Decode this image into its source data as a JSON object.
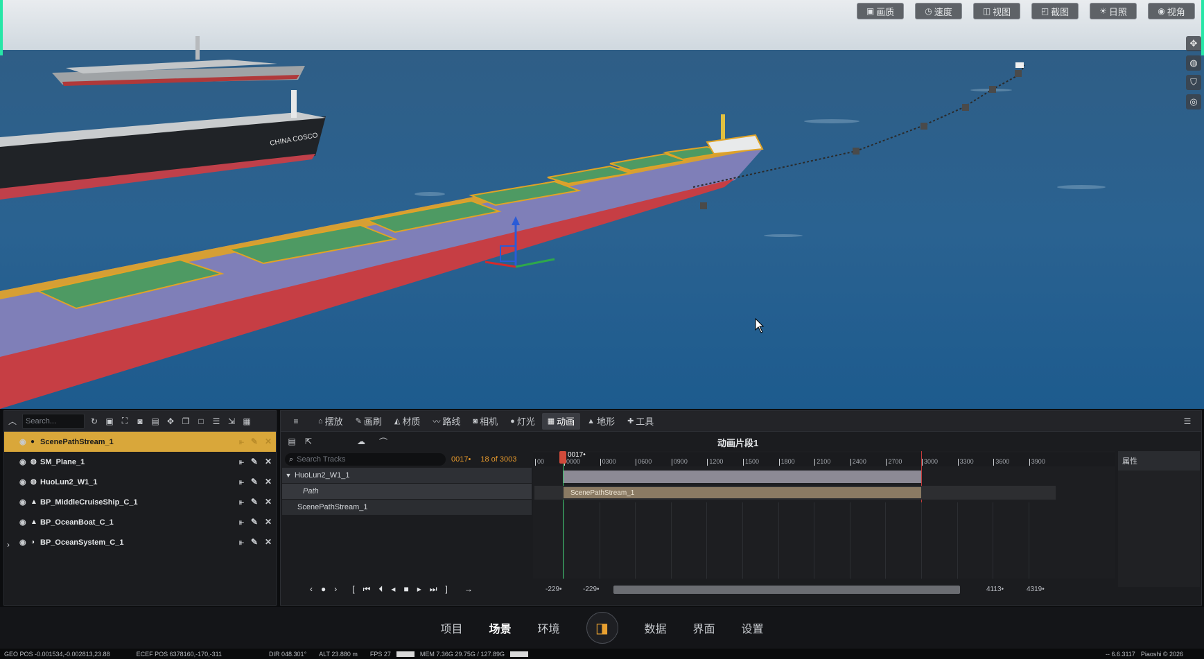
{
  "viewport": {
    "top_buttons": [
      {
        "icon": "image-icon",
        "glyph": "▣",
        "label": "画质"
      },
      {
        "icon": "speed-icon",
        "glyph": "◷",
        "label": "速度"
      },
      {
        "icon": "view-icon",
        "glyph": "◫",
        "label": "视图"
      },
      {
        "icon": "screenshot-icon",
        "glyph": "◰",
        "label": "截图"
      },
      {
        "icon": "sun-icon",
        "glyph": "☀",
        "label": "日照"
      },
      {
        "icon": "eye-icon",
        "glyph": "◉",
        "label": "视角"
      }
    ],
    "ship_hull_text": "中国远洋\nCHINA COSCO",
    "side_tools": [
      "move-icon",
      "globe-icon",
      "person-icon",
      "globe-alt-icon"
    ]
  },
  "outliner": {
    "search_placeholder": "Search...",
    "items": [
      {
        "label": "ScenePathStream_1",
        "selected": true,
        "type_glyph": "●"
      },
      {
        "label": "SM_Plane_1",
        "selected": false,
        "type_glyph": "◍"
      },
      {
        "label": "HuoLun2_W1_1",
        "selected": false,
        "type_glyph": "◍"
      },
      {
        "label": "BP_MiddleCruiseShip_C_1",
        "selected": false,
        "type_glyph": "▲"
      },
      {
        "label": "BP_OceanBoat_C_1",
        "selected": false,
        "type_glyph": "▲"
      },
      {
        "label": "BP_OceanSystem_C_1",
        "selected": false,
        "type_glyph": "◑"
      }
    ]
  },
  "editor": {
    "tabs": [
      {
        "icon": "place-icon",
        "glyph": "⌂",
        "label": "摆放",
        "active": false
      },
      {
        "icon": "brush-icon",
        "glyph": "✎",
        "label": "画刷",
        "active": false
      },
      {
        "icon": "material-icon",
        "glyph": "◭",
        "label": "材质",
        "active": false
      },
      {
        "icon": "route-icon",
        "glyph": "〰",
        "label": "路线",
        "active": false
      },
      {
        "icon": "camera-icon",
        "glyph": "◙",
        "label": "相机",
        "active": false
      },
      {
        "icon": "light-icon",
        "glyph": "●",
        "label": "灯光",
        "active": false
      },
      {
        "icon": "animation-icon",
        "glyph": "▦",
        "label": "动画",
        "active": true
      },
      {
        "icon": "terrain-icon",
        "glyph": "▲",
        "label": "地形",
        "active": false
      },
      {
        "icon": "tool-icon",
        "glyph": "✚",
        "label": "工具",
        "active": false
      }
    ],
    "clip_title": "动画片段1",
    "track_search_placeholder": "Search Tracks",
    "current_frame": "0017•",
    "frame_count": "18 of 3003",
    "tracks": [
      {
        "label": "HuoLun2_W1_1"
      },
      {
        "label": "Path"
      },
      {
        "label": "ScenePathStream_1"
      }
    ],
    "playhead_label": "0017•",
    "ruler_labels": [
      "00",
      "0000",
      "0300",
      "0600",
      "0900",
      "1200",
      "1500",
      "1800",
      "2100",
      "2400",
      "2700",
      "3000",
      "3300",
      "3600",
      "3900"
    ],
    "segment_label": "ScenePathStream_1",
    "range_start_a": "-229•",
    "range_start_b": "-229•",
    "range_end_a": "4113•",
    "range_end_b": "4319•",
    "properties_header": "属性"
  },
  "bottom_nav": {
    "items": [
      {
        "label": "项目",
        "active": false
      },
      {
        "label": "场景",
        "active": true
      },
      {
        "label": "环境",
        "active": false
      },
      {
        "label": "数据",
        "active": false
      },
      {
        "label": "界面",
        "active": false
      },
      {
        "label": "设置",
        "active": false
      }
    ]
  },
  "status": {
    "geo_pos": "GEO POS -0.001534,-0.002813,23.88",
    "ecef_pos": "ECEF POS 6378160,-170,-311",
    "dir": "DIR 048.301°",
    "alt": "ALT 23.880 m",
    "fps": "FPS 27",
    "mem": "MEM 7.36G 29.75G / 127.89G",
    "version": "-- 6.6.3117",
    "brand": "Piaoshi © 2026"
  }
}
